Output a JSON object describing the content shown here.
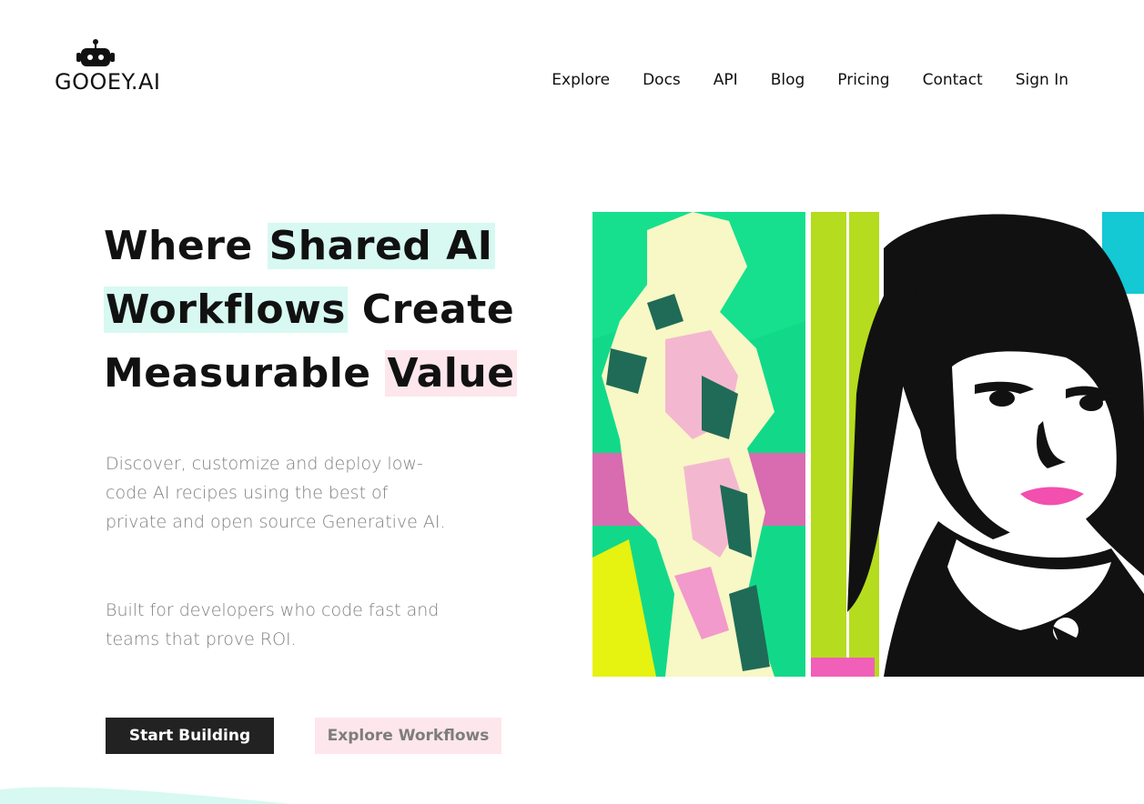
{
  "brand": {
    "name": "GOOEY.AI",
    "logo_icon": "robot-icon"
  },
  "nav": {
    "items": [
      {
        "label": "Explore"
      },
      {
        "label": "Docs"
      },
      {
        "label": "API"
      },
      {
        "label": "Blog"
      },
      {
        "label": "Pricing"
      },
      {
        "label": "Contact"
      },
      {
        "label": "Sign In"
      }
    ]
  },
  "hero": {
    "title_parts": {
      "p1": "Where ",
      "p2": "Shared AI",
      "p3": "Workflows",
      "p4": " Create",
      "p5": "Measurable ",
      "p6": "Value"
    },
    "description_1": "Discover, customize and deploy low-code AI recipes using the best of private and open source Generative AI.",
    "description_2": "Built for developers who code fast and teams that prove ROI.",
    "primary_button": "Start Building",
    "secondary_button": "Explore Workflows",
    "artwork": "pop-art-portraits-image"
  },
  "colors": {
    "highlight_mint": "#d7f9f1",
    "highlight_pink": "#fde6ec",
    "primary_button_bg": "#222222",
    "text_muted": "#808080"
  }
}
